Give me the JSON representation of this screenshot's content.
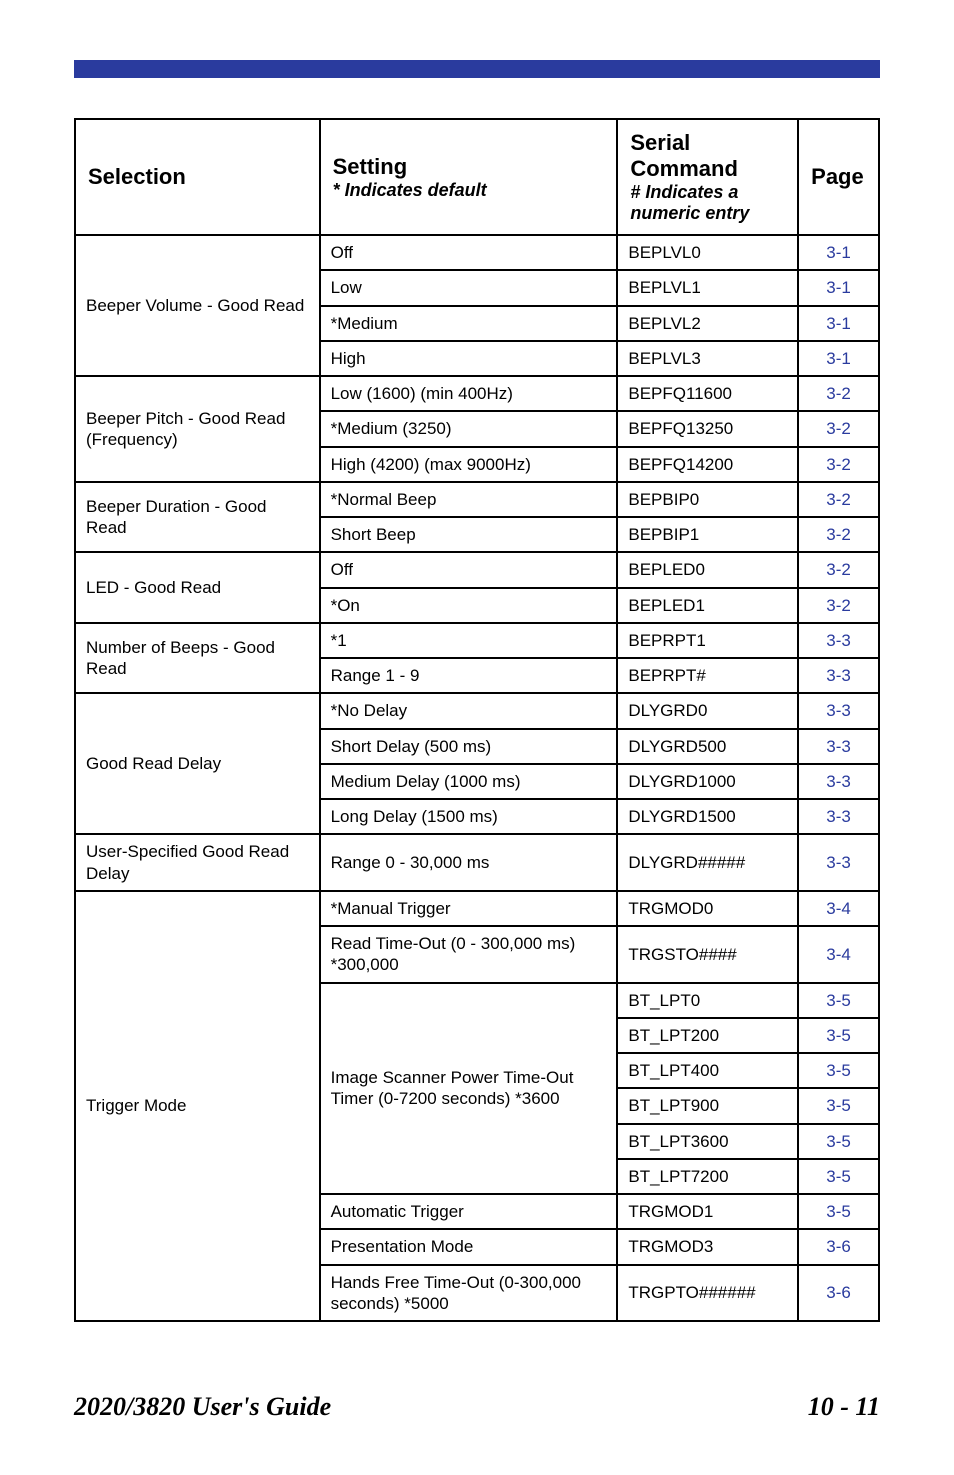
{
  "headers": {
    "selection": "Selection",
    "setting": "Setting",
    "setting_sub": "* Indicates default",
    "serial": "Serial Command",
    "serial_sub": "# Indicates a numeric entry",
    "page": "Page"
  },
  "rows": [
    {
      "selection": "Beeper Volume - Good Read",
      "settings": [
        {
          "s": "Off",
          "c": "BEPLVL0",
          "p": "3-1"
        },
        {
          "s": "Low",
          "c": "BEPLVL1",
          "p": "3-1"
        },
        {
          "s": "*Medium",
          "c": "BEPLVL2",
          "p": "3-1"
        },
        {
          "s": "High",
          "c": "BEPLVL3",
          "p": "3-1"
        }
      ]
    },
    {
      "selection": "Beeper Pitch - Good Read (Frequency)",
      "settings": [
        {
          "s": "Low (1600) (min 400Hz)",
          "c": "BEPFQ11600",
          "p": "3-2"
        },
        {
          "s": "*Medium (3250)",
          "c": "BEPFQ13250",
          "p": "3-2"
        },
        {
          "s": "High (4200) (max 9000Hz)",
          "c": "BEPFQ14200",
          "p": "3-2"
        }
      ]
    },
    {
      "selection": "Beeper Duration - Good Read",
      "settings": [
        {
          "s": "*Normal Beep",
          "c": "BEPBIP0",
          "p": "3-2"
        },
        {
          "s": "Short Beep",
          "c": "BEPBIP1",
          "p": "3-2"
        }
      ]
    },
    {
      "selection": "LED - Good Read",
      "settings": [
        {
          "s": "Off",
          "c": "BEPLED0",
          "p": "3-2"
        },
        {
          "s": "*On",
          "c": "BEPLED1",
          "p": "3-2"
        }
      ]
    },
    {
      "selection": "Number of Beeps - Good Read",
      "settings": [
        {
          "s": "*1",
          "c": "BEPRPT1",
          "p": "3-3"
        },
        {
          "s": "Range 1 - 9",
          "c": "BEPRPT#",
          "p": "3-3"
        }
      ]
    },
    {
      "selection": "Good Read Delay",
      "settings": [
        {
          "s": "*No Delay",
          "c": "DLYGRD0",
          "p": "3-3"
        },
        {
          "s": "Short Delay (500 ms)",
          "c": "DLYGRD500",
          "p": "3-3"
        },
        {
          "s": "Medium Delay (1000 ms)",
          "c": "DLYGRD1000",
          "p": "3-3"
        },
        {
          "s": "Long Delay (1500 ms)",
          "c": "DLYGRD1500",
          "p": "3-3"
        }
      ]
    },
    {
      "selection": "User-Specified Good Read Delay",
      "settings": [
        {
          "s": "Range 0 - 30,000 ms",
          "c": "DLYGRD#####",
          "p": "3-3"
        }
      ]
    },
    {
      "selection": "Trigger Mode",
      "settings": [
        {
          "s": "*Manual Trigger",
          "c": "TRGMOD0",
          "p": "3-4"
        },
        {
          "s": "Read Time-Out (0 - 300,000 ms) *300,000",
          "c": "TRGSTO####",
          "p": "3-4"
        },
        {
          "s": "Image Scanner Power Time-Out Timer (0-7200 seconds) *3600",
          "sub": [
            {
              "c": "BT_LPT0",
              "p": "3-5"
            },
            {
              "c": "BT_LPT200",
              "p": "3-5"
            },
            {
              "c": "BT_LPT400",
              "p": "3-5"
            },
            {
              "c": "BT_LPT900",
              "p": "3-5"
            },
            {
              "c": "BT_LPT3600",
              "p": "3-5"
            },
            {
              "c": "BT_LPT7200",
              "p": "3-5"
            }
          ]
        },
        {
          "s": "Automatic Trigger",
          "c": "TRGMOD1",
          "p": "3-5"
        },
        {
          "s": "Presentation Mode",
          "c": "TRGMOD3",
          "p": "3-6"
        },
        {
          "s": "Hands Free Time-Out (0-300,000 seconds) *5000",
          "c": "TRGPTO######",
          "p": "3-6"
        }
      ]
    }
  ],
  "footer": {
    "title": "2020/3820 User's Guide",
    "num": "10 - 11"
  },
  "chart_data": {
    "type": "table",
    "title": "Serial Command Reference",
    "columns": [
      "Selection",
      "Setting (* Indicates default)",
      "Serial Command (# Indicates a numeric entry)",
      "Page"
    ],
    "data": [
      [
        "Beeper Volume - Good Read",
        "Off",
        "BEPLVL0",
        "3-1"
      ],
      [
        "Beeper Volume - Good Read",
        "Low",
        "BEPLVL1",
        "3-1"
      ],
      [
        "Beeper Volume - Good Read",
        "*Medium",
        "BEPLVL2",
        "3-1"
      ],
      [
        "Beeper Volume - Good Read",
        "High",
        "BEPLVL3",
        "3-1"
      ],
      [
        "Beeper Pitch - Good Read (Frequency)",
        "Low (1600) (min 400Hz)",
        "BEPFQ11600",
        "3-2"
      ],
      [
        "Beeper Pitch - Good Read (Frequency)",
        "*Medium (3250)",
        "BEPFQ13250",
        "3-2"
      ],
      [
        "Beeper Pitch - Good Read (Frequency)",
        "High (4200) (max 9000Hz)",
        "BEPFQ14200",
        "3-2"
      ],
      [
        "Beeper Duration - Good Read",
        "*Normal Beep",
        "BEPBIP0",
        "3-2"
      ],
      [
        "Beeper Duration - Good Read",
        "Short Beep",
        "BEPBIP1",
        "3-2"
      ],
      [
        "LED - Good Read",
        "Off",
        "BEPLED0",
        "3-2"
      ],
      [
        "LED - Good Read",
        "*On",
        "BEPLED1",
        "3-2"
      ],
      [
        "Number of Beeps - Good Read",
        "*1",
        "BEPRPT1",
        "3-3"
      ],
      [
        "Number of Beeps - Good Read",
        "Range 1 - 9",
        "BEPRPT#",
        "3-3"
      ],
      [
        "Good Read Delay",
        "*No Delay",
        "DLYGRD0",
        "3-3"
      ],
      [
        "Good Read Delay",
        "Short Delay (500 ms)",
        "DLYGRD500",
        "3-3"
      ],
      [
        "Good Read Delay",
        "Medium Delay (1000 ms)",
        "DLYGRD1000",
        "3-3"
      ],
      [
        "Good Read Delay",
        "Long Delay (1500 ms)",
        "DLYGRD1500",
        "3-3"
      ],
      [
        "User-Specified Good Read Delay",
        "Range 0 - 30,000 ms",
        "DLYGRD#####",
        "3-3"
      ],
      [
        "Trigger Mode",
        "*Manual Trigger",
        "TRGMOD0",
        "3-4"
      ],
      [
        "Trigger Mode",
        "Read Time-Out (0 - 300,000 ms) *300,000",
        "TRGSTO####",
        "3-4"
      ],
      [
        "Trigger Mode",
        "Image Scanner Power Time-Out Timer (0-7200 seconds) *3600",
        "BT_LPT0",
        "3-5"
      ],
      [
        "Trigger Mode",
        "Image Scanner Power Time-Out Timer (0-7200 seconds) *3600",
        "BT_LPT200",
        "3-5"
      ],
      [
        "Trigger Mode",
        "Image Scanner Power Time-Out Timer (0-7200 seconds) *3600",
        "BT_LPT400",
        "3-5"
      ],
      [
        "Trigger Mode",
        "Image Scanner Power Time-Out Timer (0-7200 seconds) *3600",
        "BT_LPT900",
        "3-5"
      ],
      [
        "Trigger Mode",
        "Image Scanner Power Time-Out Timer (0-7200 seconds) *3600",
        "BT_LPT3600",
        "3-5"
      ],
      [
        "Trigger Mode",
        "Image Scanner Power Time-Out Timer (0-7200 seconds) *3600",
        "BT_LPT7200",
        "3-5"
      ],
      [
        "Trigger Mode",
        "Automatic Trigger",
        "TRGMOD1",
        "3-5"
      ],
      [
        "Trigger Mode",
        "Presentation Mode",
        "TRGMOD3",
        "3-6"
      ],
      [
        "Trigger Mode",
        "Hands Free Time-Out (0-300,000 seconds) *5000",
        "TRGPTO######",
        "3-6"
      ]
    ]
  }
}
